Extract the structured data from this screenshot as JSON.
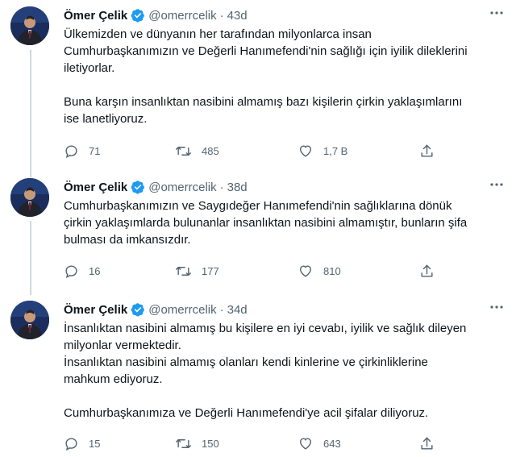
{
  "tweets": [
    {
      "name": "Ömer Çelik",
      "handle": "@omerrcelik",
      "separator": "·",
      "time": "43d",
      "text": "Ülkemizden ve dünyanın her tarafından milyonlarca insan\nCumhurbaşkanımızın ve Değerli Hanımefendi'nin sağlığı için iyilik dileklerini\niletiyorlar.\n\nBuna karşın insanlıktan nasibini almamış bazı kişilerin çirkin yaklaşımlarını\nise lanetliyoruz.",
      "replies": "71",
      "retweets": "485",
      "likes": "1,7 B"
    },
    {
      "name": "Ömer Çelik",
      "handle": "@omerrcelik",
      "separator": "·",
      "time": "38d",
      "text": "Cumhurbaşkanımızın ve Saygıdeğer Hanımefendi'nin sağlıklarına dönük\nçirkin yaklaşımlarda bulunanlar insanlıktan nasibini almamıştır, bunların şifa\nbulması da imkansızdır.",
      "replies": "16",
      "retweets": "177",
      "likes": "810"
    },
    {
      "name": "Ömer Çelik",
      "handle": "@omerrcelik",
      "separator": "·",
      "time": "34d",
      "text": "İnsanlıktan nasibini almamış bu kişilere en iyi cevabı, iyilik ve sağlık dileyen\nmilyonlar vermektedir.\nİnsanlıktan nasibini almamış olanları kendi kinlerine ve çirkinliklerine\nmahkum ediyoruz.\n\nCumhurbaşkanımıza ve Değerli Hanımefendi'ye acil şifalar diliyoruz.",
      "replies": "15",
      "retweets": "150",
      "likes": "643"
    }
  ],
  "colors": {
    "verified": "#1d9bf0",
    "muted": "#536471",
    "thread_line": "#cfd9de"
  }
}
